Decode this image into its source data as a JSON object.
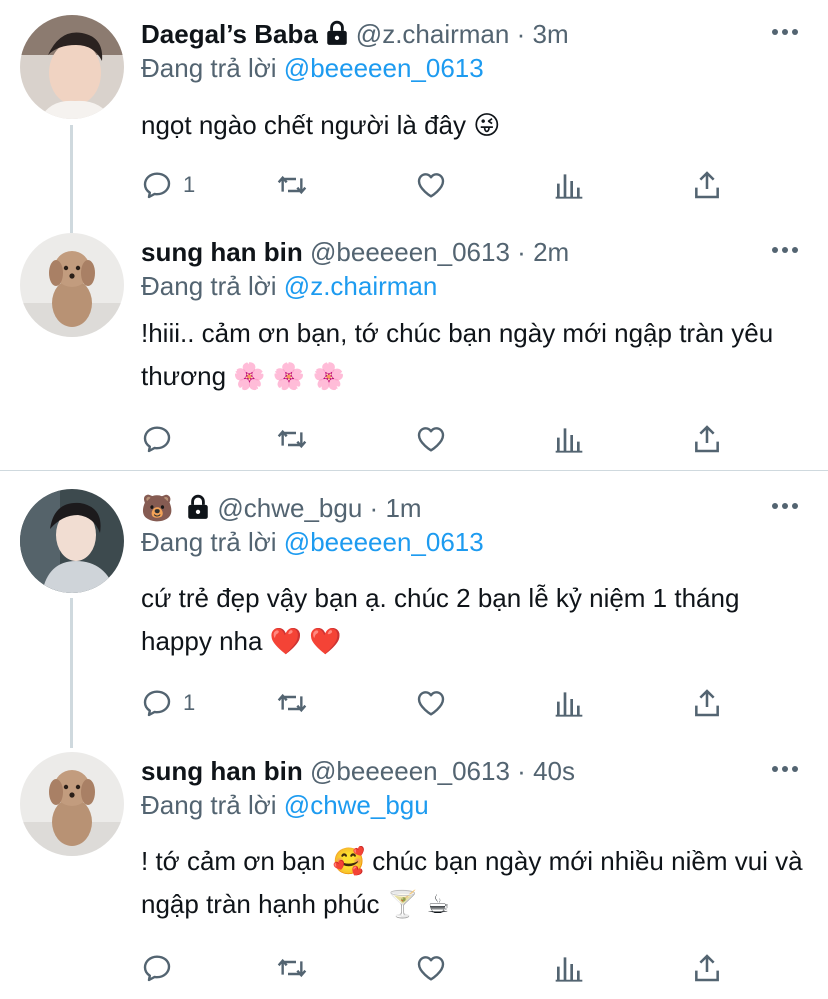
{
  "tweets": [
    {
      "name": "Daegal’s Baba",
      "locked": true,
      "handle": "@z.chairman",
      "time": "3m",
      "reply_label": "Đang trả lời",
      "reply_to": "@beeeeen_0613",
      "text": "ngọt ngào chết người là đây 😜",
      "reply_count": "1"
    },
    {
      "name": "sung han bin",
      "locked": false,
      "handle": "@beeeeen_0613",
      "time": "2m",
      "reply_label": "Đang trả lời",
      "reply_to": "@z.chairman",
      "text": "!hiii.. cảm ơn bạn, tớ chúc bạn ngày mới ngập tràn yêu thương 🌸 🌸 🌸",
      "reply_count": ""
    },
    {
      "name": "🐻",
      "locked": true,
      "handle": "@chwe_bgu",
      "time": "1m",
      "reply_label": "Đang trả lời",
      "reply_to": "@beeeeen_0613",
      "text": "cứ trẻ đẹp vậy bạn ạ. chúc 2 bạn lễ kỷ niệm 1 tháng happy nha ❤️ ❤️",
      "reply_count": "1"
    },
    {
      "name": "sung han bin",
      "locked": false,
      "handle": "@beeeeen_0613",
      "time": "40s",
      "reply_label": "Đang trả lời",
      "reply_to": "@chwe_bgu",
      "text": "! tớ cảm ơn bạn 🥰  chúc bạn ngày mới nhiều niềm vui và ngập tràn hạnh phúc 🍸 ☕",
      "reply_count": ""
    }
  ],
  "separator_symbol": "·",
  "colors": {
    "link": "#1d9bf0",
    "secondary": "#536471",
    "text": "#0f1419",
    "line": "#cfd9de"
  },
  "icons": [
    "reply-icon",
    "retweet-icon",
    "like-icon",
    "analytics-icon",
    "share-icon",
    "more-icon",
    "lock-icon"
  ]
}
